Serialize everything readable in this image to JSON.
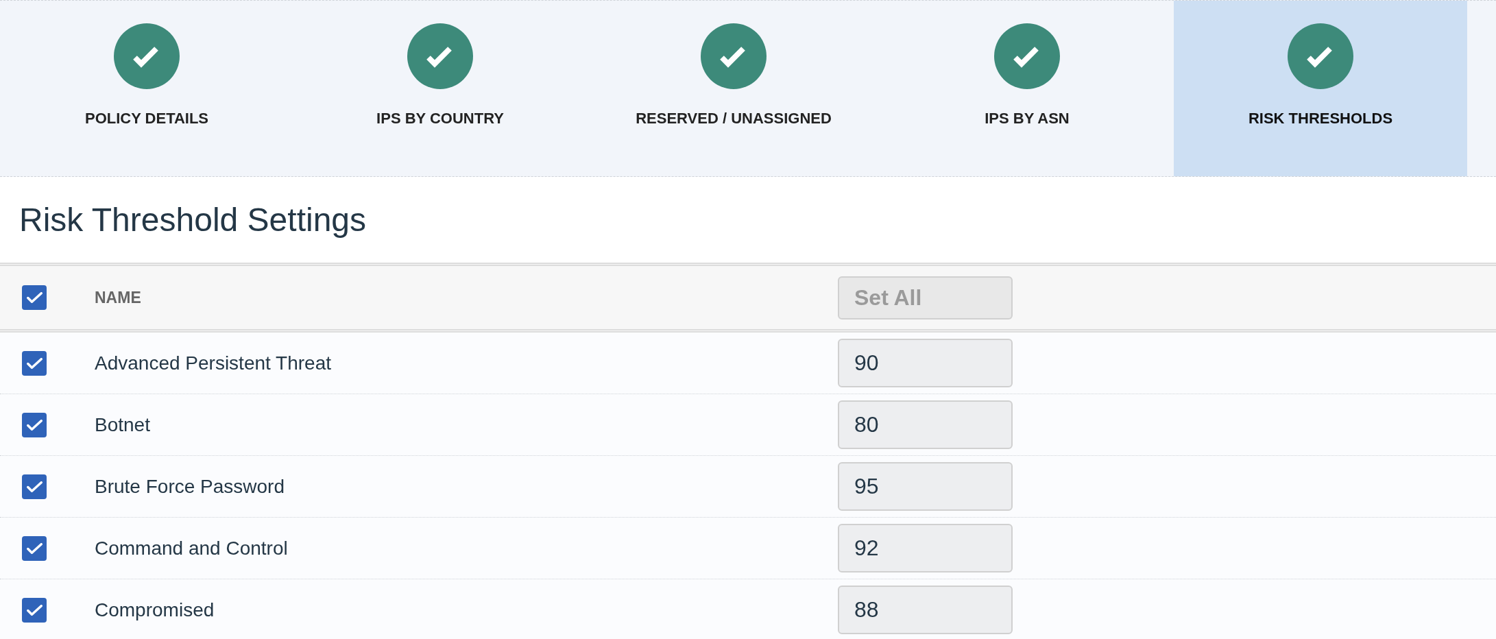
{
  "steps": [
    {
      "label": "POLICY DETAILS",
      "completed": true,
      "selected": false
    },
    {
      "label": "IPS BY COUNTRY",
      "completed": true,
      "selected": false
    },
    {
      "label": "RESERVED / UNASSIGNED",
      "completed": true,
      "selected": false
    },
    {
      "label": "IPS BY ASN",
      "completed": true,
      "selected": false
    },
    {
      "label": "RISK THRESHOLDS",
      "completed": true,
      "selected": true
    }
  ],
  "section": {
    "title": "Risk Threshold Settings"
  },
  "table": {
    "header": {
      "checked": true,
      "column_name": "NAME",
      "set_all": {
        "placeholder": "Set All"
      }
    },
    "rows": [
      {
        "checked": true,
        "name": "Advanced Persistent Threat",
        "value": "90"
      },
      {
        "checked": true,
        "name": "Botnet",
        "value": "80"
      },
      {
        "checked": true,
        "name": "Brute Force Password",
        "value": "95"
      },
      {
        "checked": true,
        "name": "Command and Control",
        "value": "92"
      },
      {
        "checked": true,
        "name": "Compromised",
        "value": "88"
      }
    ]
  }
}
